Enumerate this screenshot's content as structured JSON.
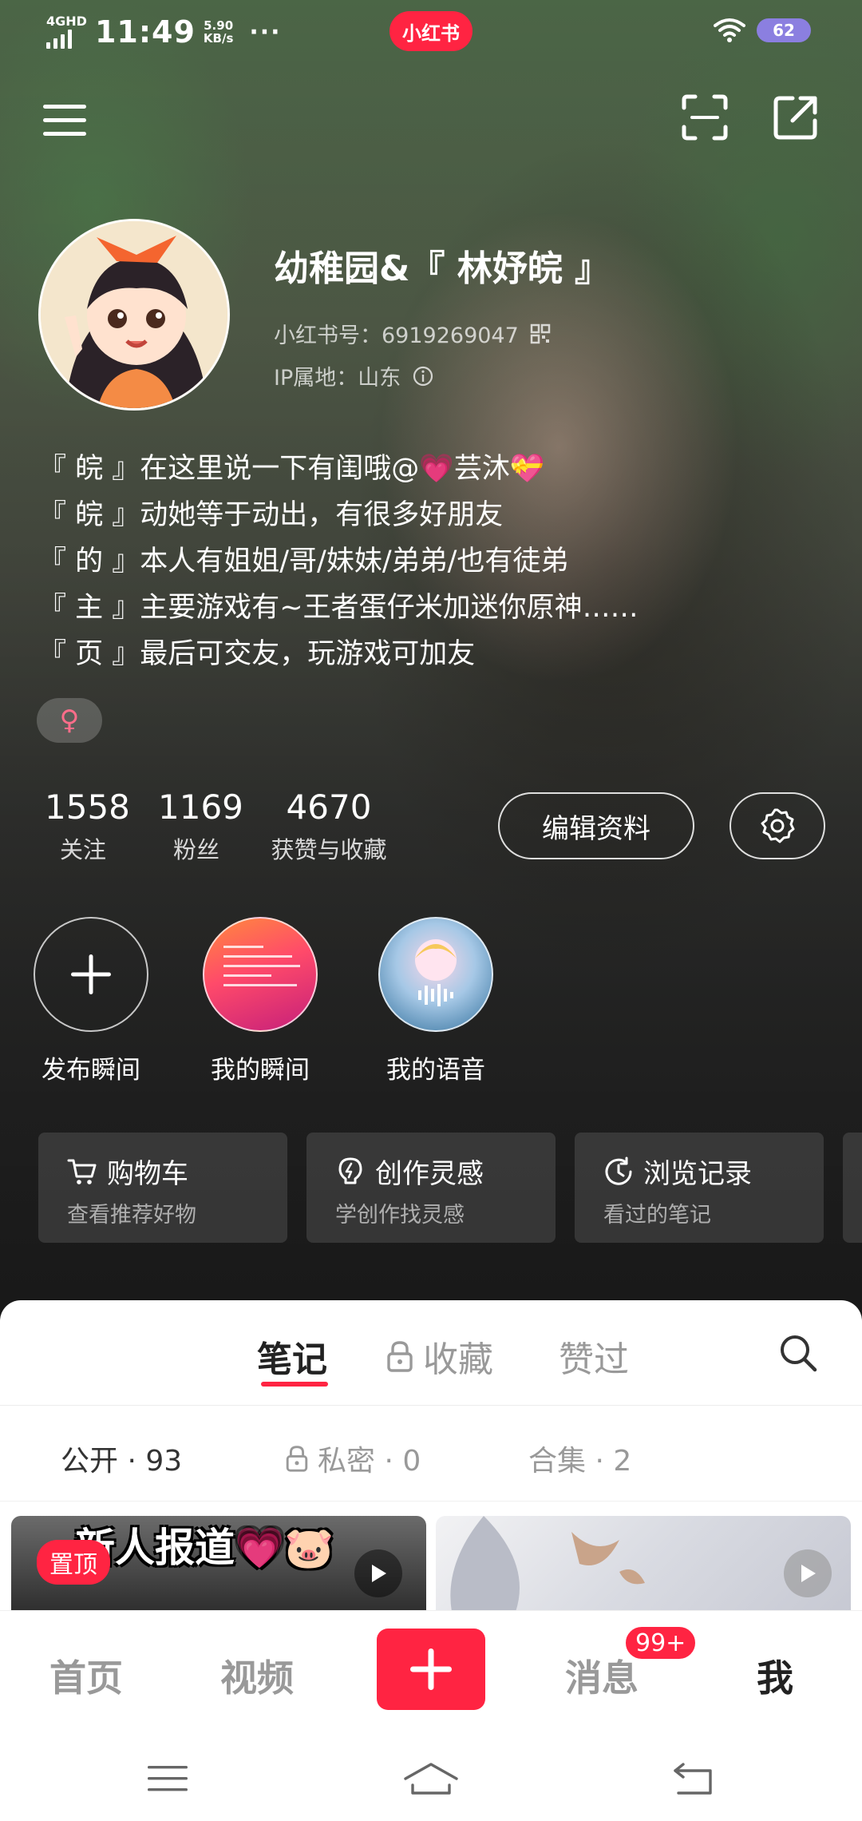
{
  "status_bar": {
    "network": "4GHD",
    "time": "11:49",
    "speed_value": "5.90",
    "speed_unit": "KB/s",
    "overflow": "···",
    "battery": "62",
    "app_badge": "小红书"
  },
  "profile": {
    "nickname": "幼稚园&『 林妤皖 』",
    "id_label": "小红书号：6919269047",
    "ip_label": "IP属地：山东",
    "bio": [
      "『 皖 』在这里说一下有闺哦@💗芸沐💝",
      "『 皖 』动她等于动出，有很多好朋友",
      "『 的 』本人有姐姐/哥/妹妹/弟弟/也有徒弟",
      "『 主 』主要游戏有~王者蛋仔米加迷你原神……",
      "『 页 』最后可交友，玩游戏可加友"
    ],
    "gender_symbol": "♀"
  },
  "stats": [
    {
      "value": "1558",
      "label": "关注"
    },
    {
      "value": "1169",
      "label": "粉丝"
    },
    {
      "value": "4670",
      "label": "获赞与收藏"
    }
  ],
  "edit_button": "编辑资料",
  "moments": [
    {
      "label": "发布瞬间"
    },
    {
      "label": "我的瞬间"
    },
    {
      "label": "我的语音"
    }
  ],
  "features": [
    {
      "title": "购物车",
      "subtitle": "查看推荐好物",
      "icon": "cart-icon"
    },
    {
      "title": "创作灵感",
      "subtitle": "学创作找灵感",
      "icon": "lightbulb-icon"
    },
    {
      "title": "浏览记录",
      "subtitle": "看过的笔记",
      "icon": "clock-icon"
    }
  ],
  "tabs": [
    "笔记",
    "收藏",
    "赞过"
  ],
  "subtabs": [
    {
      "label": "公开 · 93"
    },
    {
      "label": "私密 · 0"
    },
    {
      "label": "合集 · 2"
    }
  ],
  "notes": [
    {
      "title": "新人报道💗🐷",
      "pin": "置顶"
    }
  ],
  "bottom_nav": {
    "home": "首页",
    "video": "视频",
    "messages": "消息",
    "messages_badge": "99+",
    "me": "我"
  },
  "colors": {
    "accent": "#ff2442",
    "battery": "#8b7fe0"
  }
}
